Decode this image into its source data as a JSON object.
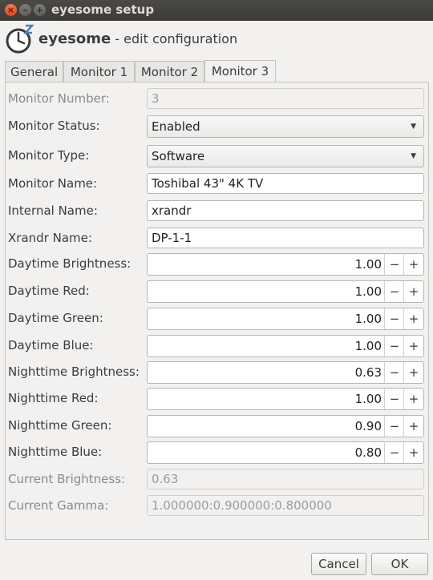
{
  "window": {
    "title": "eyesome setup",
    "close_glyph": "×",
    "min_glyph": "–",
    "max_glyph": "+"
  },
  "header": {
    "app_name": "eyesome",
    "subtitle": " - edit configuration",
    "logo_icon": "clock-z-icon"
  },
  "tabs": [
    {
      "label": "General"
    },
    {
      "label": "Monitor 1"
    },
    {
      "label": "Monitor 2"
    },
    {
      "label": "Monitor 3"
    }
  ],
  "active_tab": "Monitor 3",
  "form": {
    "monitor_number": {
      "label": "Monitor Number:",
      "value": "3"
    },
    "monitor_status": {
      "label": "Monitor Status:",
      "value": "Enabled"
    },
    "monitor_type": {
      "label": "Monitor Type:",
      "value": "Software"
    },
    "monitor_name": {
      "label": "Monitor Name:",
      "value": "Toshibal 43\" 4K TV"
    },
    "internal_name": {
      "label": "Internal Name:",
      "value": "xrandr"
    },
    "xrandr_name": {
      "label": "Xrandr Name:",
      "value": "DP-1-1"
    },
    "daytime_brightness": {
      "label": "Daytime Brightness:",
      "value": "1.00"
    },
    "daytime_red": {
      "label": "Daytime Red:",
      "value": "1.00"
    },
    "daytime_green": {
      "label": "Daytime Green:",
      "value": "1.00"
    },
    "daytime_blue": {
      "label": "Daytime Blue:",
      "value": "1.00"
    },
    "nighttime_brightness": {
      "label": "Nighttime Brightness:",
      "value": "0.63"
    },
    "nighttime_red": {
      "label": "Nighttime Red:",
      "value": "1.00"
    },
    "nighttime_green": {
      "label": "Nighttime Green:",
      "value": "0.90"
    },
    "nighttime_blue": {
      "label": "Nighttime Blue:",
      "value": "0.80"
    },
    "current_brightness": {
      "label": "Current Brightness:",
      "value": "0.63"
    },
    "current_gamma": {
      "label": "Current Gamma:",
      "value": "1.000000:0.900000:0.800000"
    }
  },
  "spin_glyphs": {
    "minus": "−",
    "plus": "+"
  },
  "combo_arrow": "▼",
  "buttons": {
    "cancel": "Cancel",
    "ok": "OK"
  },
  "colors": {
    "titlebar": "#3c3b37",
    "close_button": "#df4a16",
    "window_bg": "#f2f1f0"
  }
}
